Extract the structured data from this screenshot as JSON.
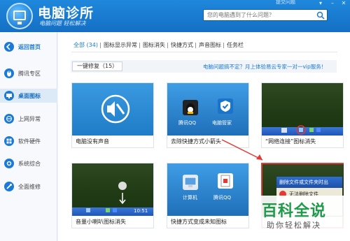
{
  "header": {
    "title": "电脑诊所",
    "slogan": "电脑问题 轻松解决",
    "feedback_link": "提交问题",
    "search_placeholder": "您的电脑遇到了什么问题？"
  },
  "sidebar": {
    "items": [
      {
        "label": "返回首页"
      },
      {
        "label": "腾讯专区"
      },
      {
        "label": "桌面图标"
      },
      {
        "label": "上网异常"
      },
      {
        "label": "软件硬件"
      },
      {
        "label": "系统综合"
      },
      {
        "label": "全面维修"
      }
    ],
    "active_index": 2
  },
  "tabs": [
    {
      "label": "全部 (34)"
    },
    {
      "label": "图标显示异常"
    },
    {
      "label": "图标消失"
    },
    {
      "label": "快捷方式"
    },
    {
      "label": "声音图标"
    },
    {
      "label": "任务栏"
    }
  ],
  "section": {
    "repair_label": "一键修复（15）",
    "help_text": "电脑问题搞不定？月上体验易云专家一对一vip服务！"
  },
  "cards": [
    {
      "caption": "电脑没有声音"
    },
    {
      "caption": "去除快捷方式小箭头",
      "icon1": "腾讯QQ",
      "icon2": "电脑管家"
    },
    {
      "caption": "“网络连接”图标消失"
    },
    {
      "caption": "音量小喇叭图标消失",
      "clock": "10:51"
    },
    {
      "caption": "快捷方式变成未知图标",
      "icon1": "计算机",
      "icon2": "腾讯QQ"
    },
    {
      "dialog_title": "删除文件或文件夹时出",
      "dialog_text": "无法删除文件"
    }
  ],
  "watermark": {
    "title": "百科全说",
    "subtitle": "助你轻松解决"
  },
  "colors": {
    "header_blue": "#1a7ad6",
    "active_tab": "#1a7ad6",
    "watermark_green": "#1f9a4a",
    "highlight_red": "#e53935"
  }
}
